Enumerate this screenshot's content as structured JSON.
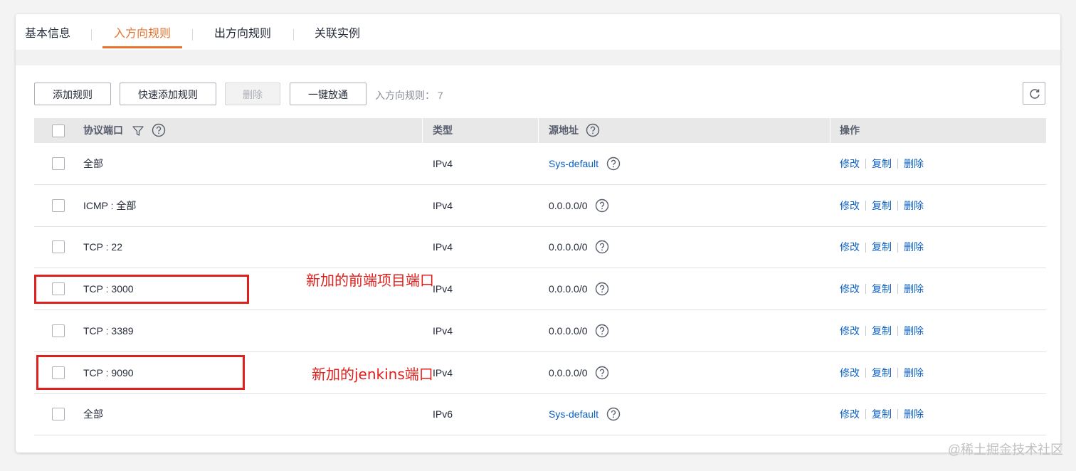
{
  "tabs": [
    {
      "label": "基本信息",
      "active": false
    },
    {
      "label": "入方向规则",
      "active": true
    },
    {
      "label": "出方向规则",
      "active": false
    },
    {
      "label": "关联实例",
      "active": false
    }
  ],
  "toolbar": {
    "add_rule": "添加规则",
    "quick_add_rule": "快速添加规则",
    "delete": "删除",
    "one_click_allow": "一键放通",
    "rule_count_label": "入方向规则：",
    "rule_count": "7"
  },
  "table": {
    "headers": {
      "protocol_port": "协议端口",
      "type": "类型",
      "source": "源地址",
      "actions": "操作"
    },
    "rows": [
      {
        "protocol_port": "全部",
        "type": "IPv4",
        "source": "Sys-default",
        "source_is_link": true
      },
      {
        "protocol_port": "ICMP : 全部",
        "type": "IPv4",
        "source": "0.0.0.0/0",
        "source_is_link": false
      },
      {
        "protocol_port": "TCP : 22",
        "type": "IPv4",
        "source": "0.0.0.0/0",
        "source_is_link": false
      },
      {
        "protocol_port": "TCP : 3000",
        "type": "IPv4",
        "source": "0.0.0.0/0",
        "source_is_link": false
      },
      {
        "protocol_port": "TCP : 3389",
        "type": "IPv4",
        "source": "0.0.0.0/0",
        "source_is_link": false
      },
      {
        "protocol_port": "TCP : 9090",
        "type": "IPv4",
        "source": "0.0.0.0/0",
        "source_is_link": false
      },
      {
        "protocol_port": "全部",
        "type": "IPv6",
        "source": "Sys-default",
        "source_is_link": true
      }
    ],
    "actions": {
      "modify": "修改",
      "copy": "复制",
      "delete": "删除"
    }
  },
  "annotations": {
    "frontend_port": "新加的前端项目端口",
    "jenkins_port": "新加的jenkins端口"
  },
  "watermark": "@稀土掘金技术社区",
  "colors": {
    "accent": "#e6722b",
    "link": "#0b5fc5",
    "annotation_red": "#e0201c"
  },
  "icons": {
    "filter": "filter-icon",
    "help": "question-circle-icon",
    "refresh": "refresh-icon"
  }
}
